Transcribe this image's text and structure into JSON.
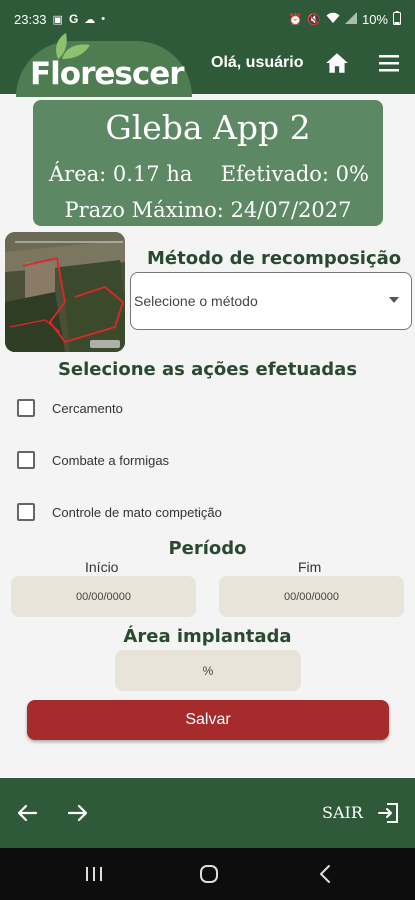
{
  "status_bar": {
    "time": "23:33",
    "battery": "10%",
    "left_icons": [
      "gallery-icon",
      "google-icon",
      "cloud-icon",
      "dot-icon"
    ],
    "right_icons": [
      "alarm-icon",
      "mute-icon",
      "wifi-icon",
      "signal-icon",
      "battery-icon"
    ]
  },
  "header": {
    "logo_text": "Florescer",
    "greeting": "Olá, usuário",
    "colors": {
      "bar": "#2f5a3a",
      "logo_bg": "#4e7d52",
      "leaf": "#8dc26f"
    }
  },
  "gleba": {
    "title": "Gleba App 2",
    "area": "Área: 0.17 ha",
    "efetivado": "Efetivado: 0%",
    "prazo": "Prazo Máximo: 24/07/2027",
    "card_color": "#5c8863"
  },
  "metodo": {
    "label": "Método de recomposição",
    "placeholder": "Selecione o método"
  },
  "acoes": {
    "label": "Selecione as ações efetuadas",
    "items": [
      {
        "label": "Cercamento",
        "checked": false
      },
      {
        "label": "Combate a formigas",
        "checked": false
      },
      {
        "label": "Controle de mato competição",
        "checked": false
      }
    ]
  },
  "periodo": {
    "label": "Período",
    "inicio_label": "Início",
    "fim_label": "Fim",
    "inicio_placeholder": "00/00/0000",
    "fim_placeholder": "00/00/0000"
  },
  "area_implantada": {
    "label": "Área implantada",
    "placeholder": "%"
  },
  "actions": {
    "save_label": "Salvar",
    "save_color": "#a62b2c"
  },
  "bottom_bar": {
    "exit_label": "SAIR",
    "icons": [
      "arrow-left-icon",
      "arrow-right-icon",
      "logout-icon"
    ]
  },
  "android_nav": {
    "icons": [
      "recent-apps-icon",
      "home-circle-icon",
      "back-chevron-icon"
    ]
  }
}
